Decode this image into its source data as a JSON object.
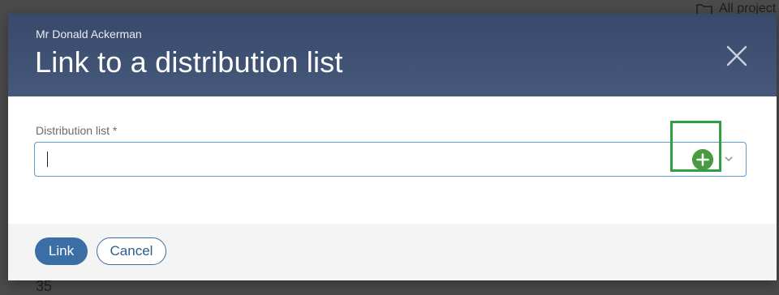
{
  "background": {
    "projects_label": "All project",
    "row_number": "35"
  },
  "dialog": {
    "subtitle": "Mr Donald Ackerman",
    "title": "Link to a distribution list",
    "field": {
      "label": "Distribution list *",
      "value": ""
    },
    "buttons": {
      "link": "Link",
      "cancel": "Cancel"
    }
  },
  "colors": {
    "header": "#3f5273",
    "primary": "#3a6ea5",
    "add": "#4a9b3f",
    "highlight": "#2ea043"
  },
  "icons": {
    "close": "close-icon",
    "add": "plus-circle-icon",
    "dropdown": "chevron-down-icon",
    "folder": "folder-icon"
  }
}
